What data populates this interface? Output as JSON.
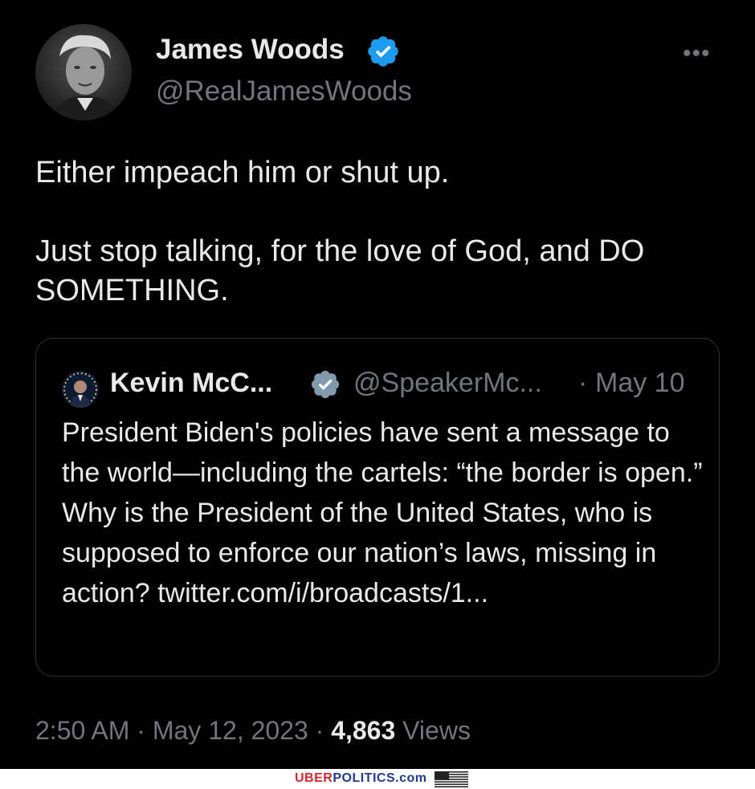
{
  "author": {
    "name": "James Woods",
    "handle": "@RealJamesWoods"
  },
  "tweet": {
    "text": "Either impeach him or shut up.\n\nJust stop talking, for the love of God, and DO SOMETHING."
  },
  "quoted": {
    "name": "Kevin McC...",
    "handle": "@SpeakerMc...",
    "dot": "·",
    "date": "May 10",
    "text": "President Biden's policies have sent a message to the world—including the cartels: “the border is open.”  Why is the President of the United States, who is supposed to enforce our nation’s laws, missing in action? twitter.com/i/broadcasts/1..."
  },
  "meta": {
    "time": "2:50 AM · May 12, 2023 · ",
    "views_count": "4,863",
    "views_label": " Views"
  },
  "icons": {
    "verified": "verified-badge-icon",
    "more": "more-options-icon",
    "flag": "us-flag-icon"
  },
  "watermark": {
    "part1": "UBER",
    "part2": "POLITICS.com"
  },
  "colors": {
    "background": "#000000",
    "verified_main": "#1d9bf0",
    "verified_gov": "#829aab",
    "text_primary": "#e7e9ea",
    "text_secondary": "#71767b",
    "brand_red": "#d9232d",
    "brand_blue": "#1f3a93"
  }
}
